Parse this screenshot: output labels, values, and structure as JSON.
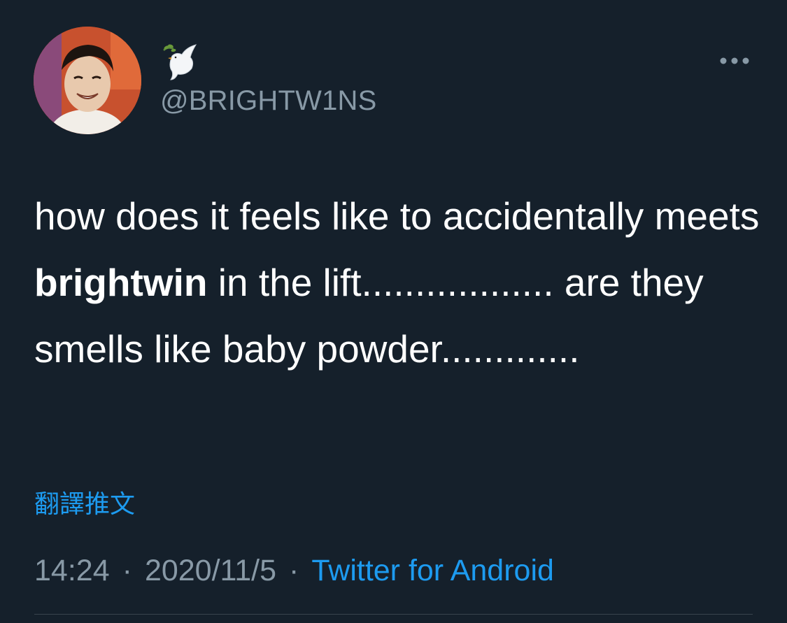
{
  "tweet": {
    "handle": "@BRIGHTW1NS",
    "display_name_icon": "dove-with-olive-branch-icon",
    "text_parts": [
      "how does it feels like to accidentally meets ",
      "brightwin",
      " in the lift.................. are they smells like baby powder............."
    ],
    "translate_label": "翻譯推文",
    "time": "14:24",
    "date": "2020/11/5",
    "separator": "·",
    "source": "Twitter for Android"
  },
  "colors": {
    "background": "#15202b",
    "text": "#ffffff",
    "secondary": "#8899a6",
    "accent": "#1d9bf0"
  }
}
